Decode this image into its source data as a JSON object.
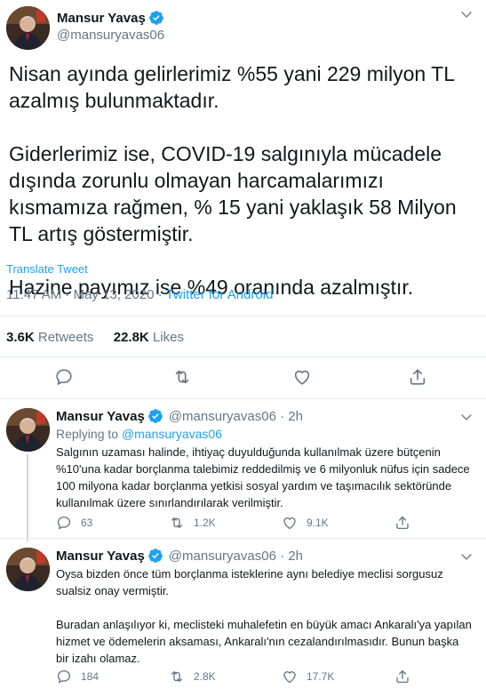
{
  "main_tweet": {
    "author_name": "Mansur Yavaş",
    "author_handle": "@mansuryavas06",
    "paragraphs": [
      "Nisan ayında gelirlerimiz %55 yani 229 milyon TL azalmış bulunmaktadır.",
      "Giderlerimiz ise, COVID-19 salgınıyla mücadele dışında zorunlu olmayan harcamalarımızı kısmamıza rağmen, % 15 yani yaklaşık 58 Milyon TL artış göstermiştir.",
      "Hazine payımız ise %49 oranında azalmıştır."
    ],
    "translate_label": "Translate Tweet",
    "time": "11:47 AM · May 13, 2020 · ",
    "source": "Twitter for Android",
    "retweets_count": "3.6K",
    "retweets_label": "Retweets",
    "likes_count": "22.8K",
    "likes_label": "Likes"
  },
  "replies": [
    {
      "author_name": "Mansur Yavaş",
      "author_handle": "@mansuryavas06 · 2h",
      "replying_label": "Replying to ",
      "replying_handle": "@mansuryavas06",
      "text": "Salgının uzaması halinde, ihtiyaç duyulduğunda kullanılmak üzere bütçenin %10'una kadar borçlanma talebimiz reddedilmiş ve 6 milyonluk nüfus için sadece 100 milyona kadar borçlanma yetkisi sosyal yardım ve taşımacılık sektöründe kullanılmak üzere sınırlandırılarak verilmiştir.",
      "reply_count": "63",
      "retweet_count": "1.2K",
      "like_count": "9.1K"
    },
    {
      "author_name": "Mansur Yavaş",
      "author_handle": "@mansuryavas06 · 2h",
      "text_1": "Oysa bizden önce tüm borçlanma isteklerine aynı belediye meclisi sorgusuz sualsiz onay vermiştir.",
      "text_2": "Buradan anlaşılıyor ki, meclisteki muhalefetin en büyük amacı Ankaralı'ya yapılan hizmet ve ödemelerin aksaması, Ankaralı'nın cezalandırılmasıdır. Bunun başka bir izahı olamaz.",
      "reply_count": "184",
      "retweet_count": "2.8K",
      "like_count": "17.7K"
    }
  ],
  "colors": {
    "accent": "#1da1f2",
    "secondary_text": "#657786",
    "divider": "#e6ecf0",
    "like_red": "#e0245e"
  },
  "icons": [
    "verified-badge-icon",
    "chevron-down-icon",
    "reply-icon",
    "retweet-icon",
    "like-icon",
    "share-icon"
  ]
}
